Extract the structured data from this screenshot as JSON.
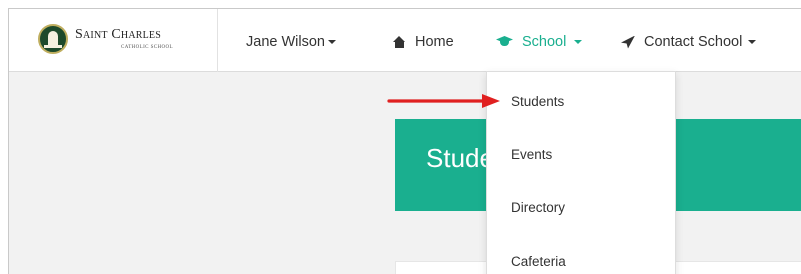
{
  "brand": {
    "name": "Saint Charles",
    "subtitle": "CATHOLIC SCHOOL"
  },
  "nav": {
    "user_label": "Jane Wilson",
    "home_label": "Home",
    "school_label": "School",
    "contact_label": "Contact School"
  },
  "dropdown": {
    "items": [
      "Students",
      "Events",
      "Directory",
      "Cafeteria"
    ]
  },
  "page": {
    "banner_title": "Students"
  },
  "colors": {
    "accent": "#1aaf8f",
    "arrow": "#e02020"
  },
  "icons": {
    "home": "home-icon",
    "school": "graduation-cap-icon",
    "contact": "paper-plane-icon"
  }
}
